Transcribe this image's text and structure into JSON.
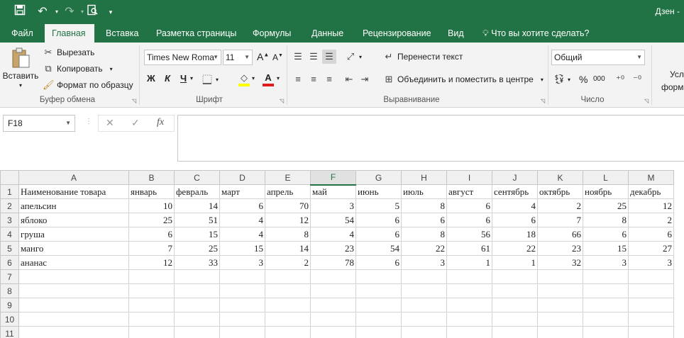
{
  "window": {
    "user": "Дзен -"
  },
  "quick_access": {
    "save": "save-icon",
    "undo": "undo-icon",
    "redo": "redo-icon",
    "preview": "print-preview-icon",
    "customize": "▾"
  },
  "tabs": [
    "Файл",
    "Главная",
    "Вставка",
    "Разметка страницы",
    "Формулы",
    "Данные",
    "Рецензирование",
    "Вид"
  ],
  "tell_me": "Что вы хотите сделать?",
  "clipboard": {
    "paste": "Вставить",
    "cut": "Вырезать",
    "copy": "Копировать",
    "format_painter": "Формат по образцу",
    "label": "Буфер обмена"
  },
  "font": {
    "name": "Times New Roma",
    "size": "11",
    "bold": "Ж",
    "italic": "К",
    "underline": "Ч",
    "label": "Шрифт"
  },
  "alignment": {
    "wrap": "Перенести текст",
    "merge": "Объединить и поместить в центре",
    "label": "Выравнивание"
  },
  "number": {
    "format": "Общий",
    "percent": "%",
    "thousands": "000",
    "label": "Число"
  },
  "styles": {
    "conditional_top": "Усл",
    "conditional_bottom": "формат"
  },
  "formula_bar": {
    "name_box": "F18",
    "cancel": "✕",
    "enter": "✓",
    "fx": "fx"
  },
  "columns": [
    "A",
    "B",
    "C",
    "D",
    "E",
    "F",
    "G",
    "H",
    "I",
    "J",
    "K",
    "L",
    "M"
  ],
  "selected_column": "F",
  "header_row": [
    "Наименование товара",
    "январь",
    "февраль",
    "март",
    "апрель",
    "май",
    "июнь",
    "июль",
    "август",
    "сентябрь",
    "октябрь",
    "ноябрь",
    "декабрь"
  ],
  "rows": [
    {
      "name": "апельсин",
      "values": [
        "10",
        "14",
        "6",
        "70",
        "3",
        "5",
        "8",
        "6",
        "4",
        "2",
        "25",
        "12"
      ]
    },
    {
      "name": "яблоко",
      "values": [
        "25",
        "51",
        "4",
        "12",
        "54",
        "6",
        "6",
        "6",
        "6",
        "7",
        "8",
        "2"
      ]
    },
    {
      "name": "груша",
      "values": [
        "6",
        "15",
        "4",
        "8",
        "4",
        "6",
        "8",
        "56",
        "18",
        "66",
        "6",
        "6"
      ]
    },
    {
      "name": "манго",
      "values": [
        "7",
        "25",
        "15",
        "14",
        "23",
        "54",
        "22",
        "61",
        "22",
        "23",
        "15",
        "27"
      ]
    },
    {
      "name": "ананас",
      "values": [
        "12",
        "33",
        "3",
        "2",
        "78",
        "6",
        "3",
        "1",
        "1",
        "32",
        "3",
        "3"
      ]
    }
  ],
  "row_numbers": [
    "1",
    "2",
    "3",
    "4",
    "5",
    "6",
    "7",
    "8",
    "9",
    "10",
    "11"
  ]
}
